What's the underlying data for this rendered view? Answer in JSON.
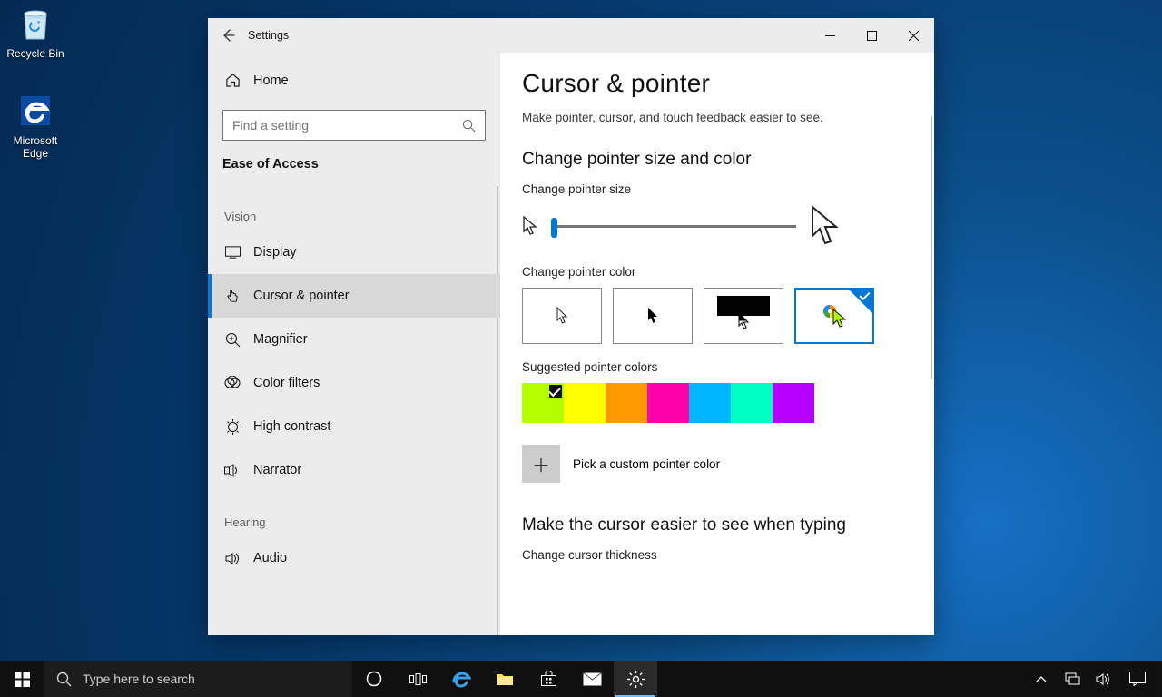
{
  "desktop": {
    "recycle": "Recycle Bin",
    "edge": "Microsoft Edge"
  },
  "window": {
    "title": "Settings",
    "home": "Home",
    "search_placeholder": "Find a setting",
    "section": "Ease of Access",
    "groups": {
      "vision": "Vision",
      "hearing": "Hearing"
    },
    "sidebar": {
      "display": "Display",
      "cursor": "Cursor & pointer",
      "magnifier": "Magnifier",
      "color_filters": "Color filters",
      "high_contrast": "High contrast",
      "narrator": "Narrator",
      "audio": "Audio"
    }
  },
  "content": {
    "h1": "Cursor & pointer",
    "lead": "Make pointer, cursor, and touch feedback easier to see.",
    "section1": "Change pointer size and color",
    "size_label": "Change pointer size",
    "color_label": "Change pointer color",
    "suggested_label": "Suggested pointer colors",
    "suggested_colors": [
      "#b3ff00",
      "#ffff00",
      "#ff9900",
      "#ff00aa",
      "#00b7ff",
      "#00ffc3",
      "#b500ff"
    ],
    "selected_suggested_index": 0,
    "custom_label": "Pick a custom pointer color",
    "section2": "Make the cursor easier to see when typing",
    "thickness_label": "Change cursor thickness"
  },
  "taskbar": {
    "search_placeholder": "Type here to search"
  }
}
